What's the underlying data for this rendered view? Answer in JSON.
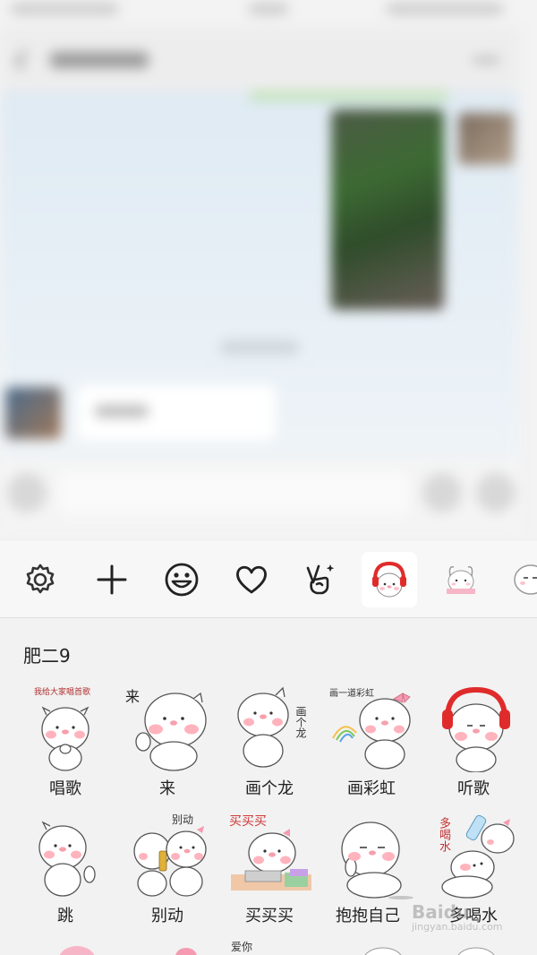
{
  "toolbar": {
    "icons": [
      "settings-gear-icon",
      "add-plus-icon",
      "emoji-smiley-icon",
      "favorites-heart-icon",
      "peace-hand-icon",
      "headphone-pig-pack-icon",
      "bunny-pack-icon",
      "face-pack-icon"
    ]
  },
  "panel": {
    "title": "肥二9",
    "stickers": [
      {
        "label": "唱歌",
        "caption": "我给大家唱首歌"
      },
      {
        "label": "来",
        "caption": "来"
      },
      {
        "label": "画个龙",
        "caption": "画个龙"
      },
      {
        "label": "画彩虹",
        "caption": "画一道彩虹"
      },
      {
        "label": "听歌",
        "caption": ""
      },
      {
        "label": "跳",
        "caption": ""
      },
      {
        "label": "别动",
        "caption": "别动"
      },
      {
        "label": "买买买",
        "caption": "买买买"
      },
      {
        "label": "抱抱自己",
        "caption": ""
      },
      {
        "label": "多喝水",
        "caption": "多喝水"
      }
    ],
    "partial_caption": "爱你"
  },
  "watermark": {
    "brand": "Baidu",
    "sub": "jingyan.baidu.com"
  },
  "colors": {
    "cheek": "#ffb3bd",
    "nose": "#f7a0ad",
    "headphone": "#e02b2b",
    "bow": "#f59ab0"
  }
}
